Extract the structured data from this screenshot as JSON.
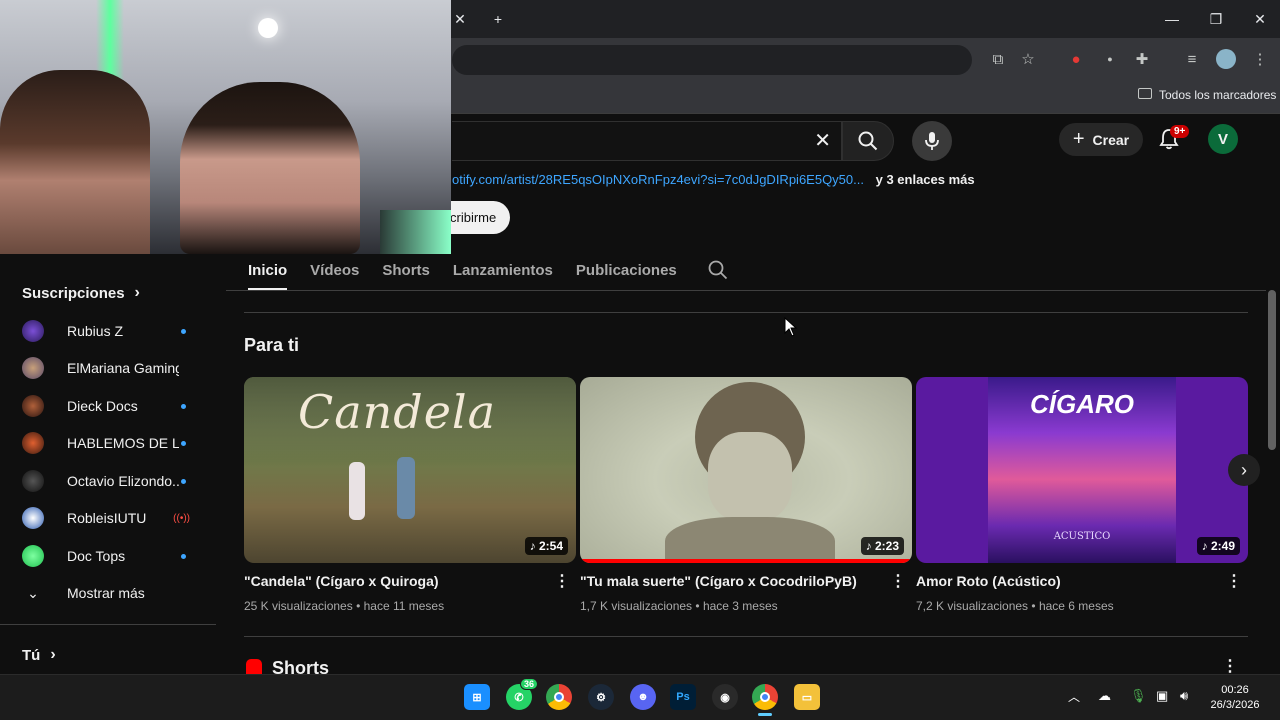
{
  "browser": {
    "bookmarks_label": "Todos los marcadores"
  },
  "youtube": {
    "create_label": "Crear",
    "notifications_badge": "9+",
    "avatar_letter": "V",
    "links": {
      "url": "otify.com/artist/28RE5qsOIpNXoRnFpz4evi?si=7c0dJgDIRpi6E5Qy50...",
      "more": "y 3 enlaces más"
    },
    "subscribe_label": "cribirme",
    "tabs": [
      "Inicio",
      "Vídeos",
      "Shorts",
      "Lanzamientos",
      "Publicaciones"
    ],
    "section_title": "Para ti",
    "shorts_title": "Shorts",
    "videos": [
      {
        "title": "\"Candela\" (Cígaro x Quiroga)",
        "duration": "2:54",
        "views": "25 K visualizaciones",
        "age": "hace 11 meses",
        "thumb_text": "Candela",
        "progress": 0
      },
      {
        "title": "\"Tu mala suerte\" (Cígaro x CocodriloPyB)",
        "duration": "2:23",
        "views": "1,7 K visualizaciones",
        "age": "hace 3 meses",
        "thumb_text": "",
        "progress": 1.0
      },
      {
        "title": "Amor Roto (Acústico)",
        "duration": "2:49",
        "views": "7,2 K visualizaciones",
        "age": "hace 6 meses",
        "thumb_text": "CÍGARO",
        "thumb_subtext": "ACUSTICO",
        "progress": 0
      }
    ]
  },
  "sidebar": {
    "subscriptions_title": "Suscripciones",
    "items": [
      {
        "name": "Rubius Z",
        "status": "new"
      },
      {
        "name": "ElMariana Gaming",
        "status": ""
      },
      {
        "name": "Dieck Docs",
        "status": "new"
      },
      {
        "name": "HABLEMOS DE L...",
        "status": "new"
      },
      {
        "name": "Octavio Elizondo...",
        "status": "new"
      },
      {
        "name": "RobleisIUTU",
        "status": "live"
      },
      {
        "name": "Doc Tops",
        "status": "new"
      }
    ],
    "show_more": "Mostrar más",
    "you_title": "Tú"
  },
  "taskbar": {
    "whatsapp_badge": "36",
    "time": "00:26",
    "date": "26/3/2026"
  },
  "colors": {
    "accent_red": "#ff0000",
    "link_blue": "#3ea6ff",
    "background": "#0f0f0f"
  }
}
